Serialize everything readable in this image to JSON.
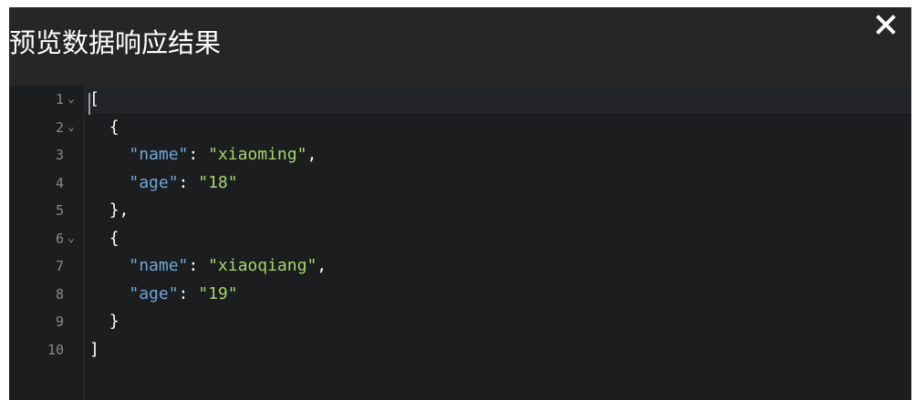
{
  "dialog": {
    "title": "预览数据响应结果",
    "close_icon": "close-icon"
  },
  "editor": {
    "lines": [
      {
        "number": "1",
        "foldable": true,
        "indent": "",
        "key": "",
        "value": "",
        "text": "["
      },
      {
        "number": "2",
        "foldable": true,
        "indent": "  ",
        "key": "",
        "value": "",
        "text": "{"
      },
      {
        "number": "3",
        "foldable": false,
        "indent": "    ",
        "key": "\"name\"",
        "sep": ": ",
        "value": "\"xiaoming\"",
        "tail": ","
      },
      {
        "number": "4",
        "foldable": false,
        "indent": "    ",
        "key": "\"age\"",
        "sep": ": ",
        "value": "\"18\"",
        "tail": ""
      },
      {
        "number": "5",
        "foldable": false,
        "indent": "  ",
        "key": "",
        "value": "",
        "text": "},"
      },
      {
        "number": "6",
        "foldable": true,
        "indent": "  ",
        "key": "",
        "value": "",
        "text": "{"
      },
      {
        "number": "7",
        "foldable": false,
        "indent": "    ",
        "key": "\"name\"",
        "sep": ": ",
        "value": "\"xiaoqiang\"",
        "tail": ","
      },
      {
        "number": "8",
        "foldable": false,
        "indent": "    ",
        "key": "\"age\"",
        "sep": ": ",
        "value": "\"19\"",
        "tail": ""
      },
      {
        "number": "9",
        "foldable": false,
        "indent": "  ",
        "key": "",
        "value": "",
        "text": "}"
      },
      {
        "number": "10",
        "foldable": false,
        "indent": "",
        "key": "",
        "value": "",
        "text": "]"
      }
    ],
    "fold_glyph": "⌄",
    "colors": {
      "key": "#6fa6d8",
      "string": "#a6d66a",
      "punct": "#ffffff",
      "line_number": "#8a8a8a"
    }
  }
}
